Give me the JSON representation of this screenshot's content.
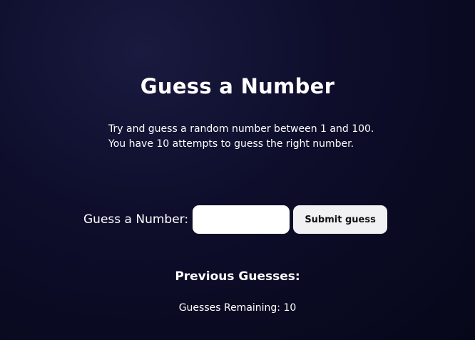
{
  "page": {
    "title": "Guess a Number",
    "description_line1": "Try and guess a random number between 1 and 100.",
    "description_line2": "You have 10 attempts to guess the right number."
  },
  "form": {
    "label": "Guess a Number:",
    "input_value": "",
    "submit_label": "Submit guess"
  },
  "results": {
    "previous_heading": "Previous Guesses:",
    "remaining_text": "Guesses Remaining: 10"
  },
  "colors": {
    "background": "#0f0f2e",
    "text": "#ffffff",
    "input_bg": "#ffffff",
    "button_bg": "#f1f1f4"
  }
}
